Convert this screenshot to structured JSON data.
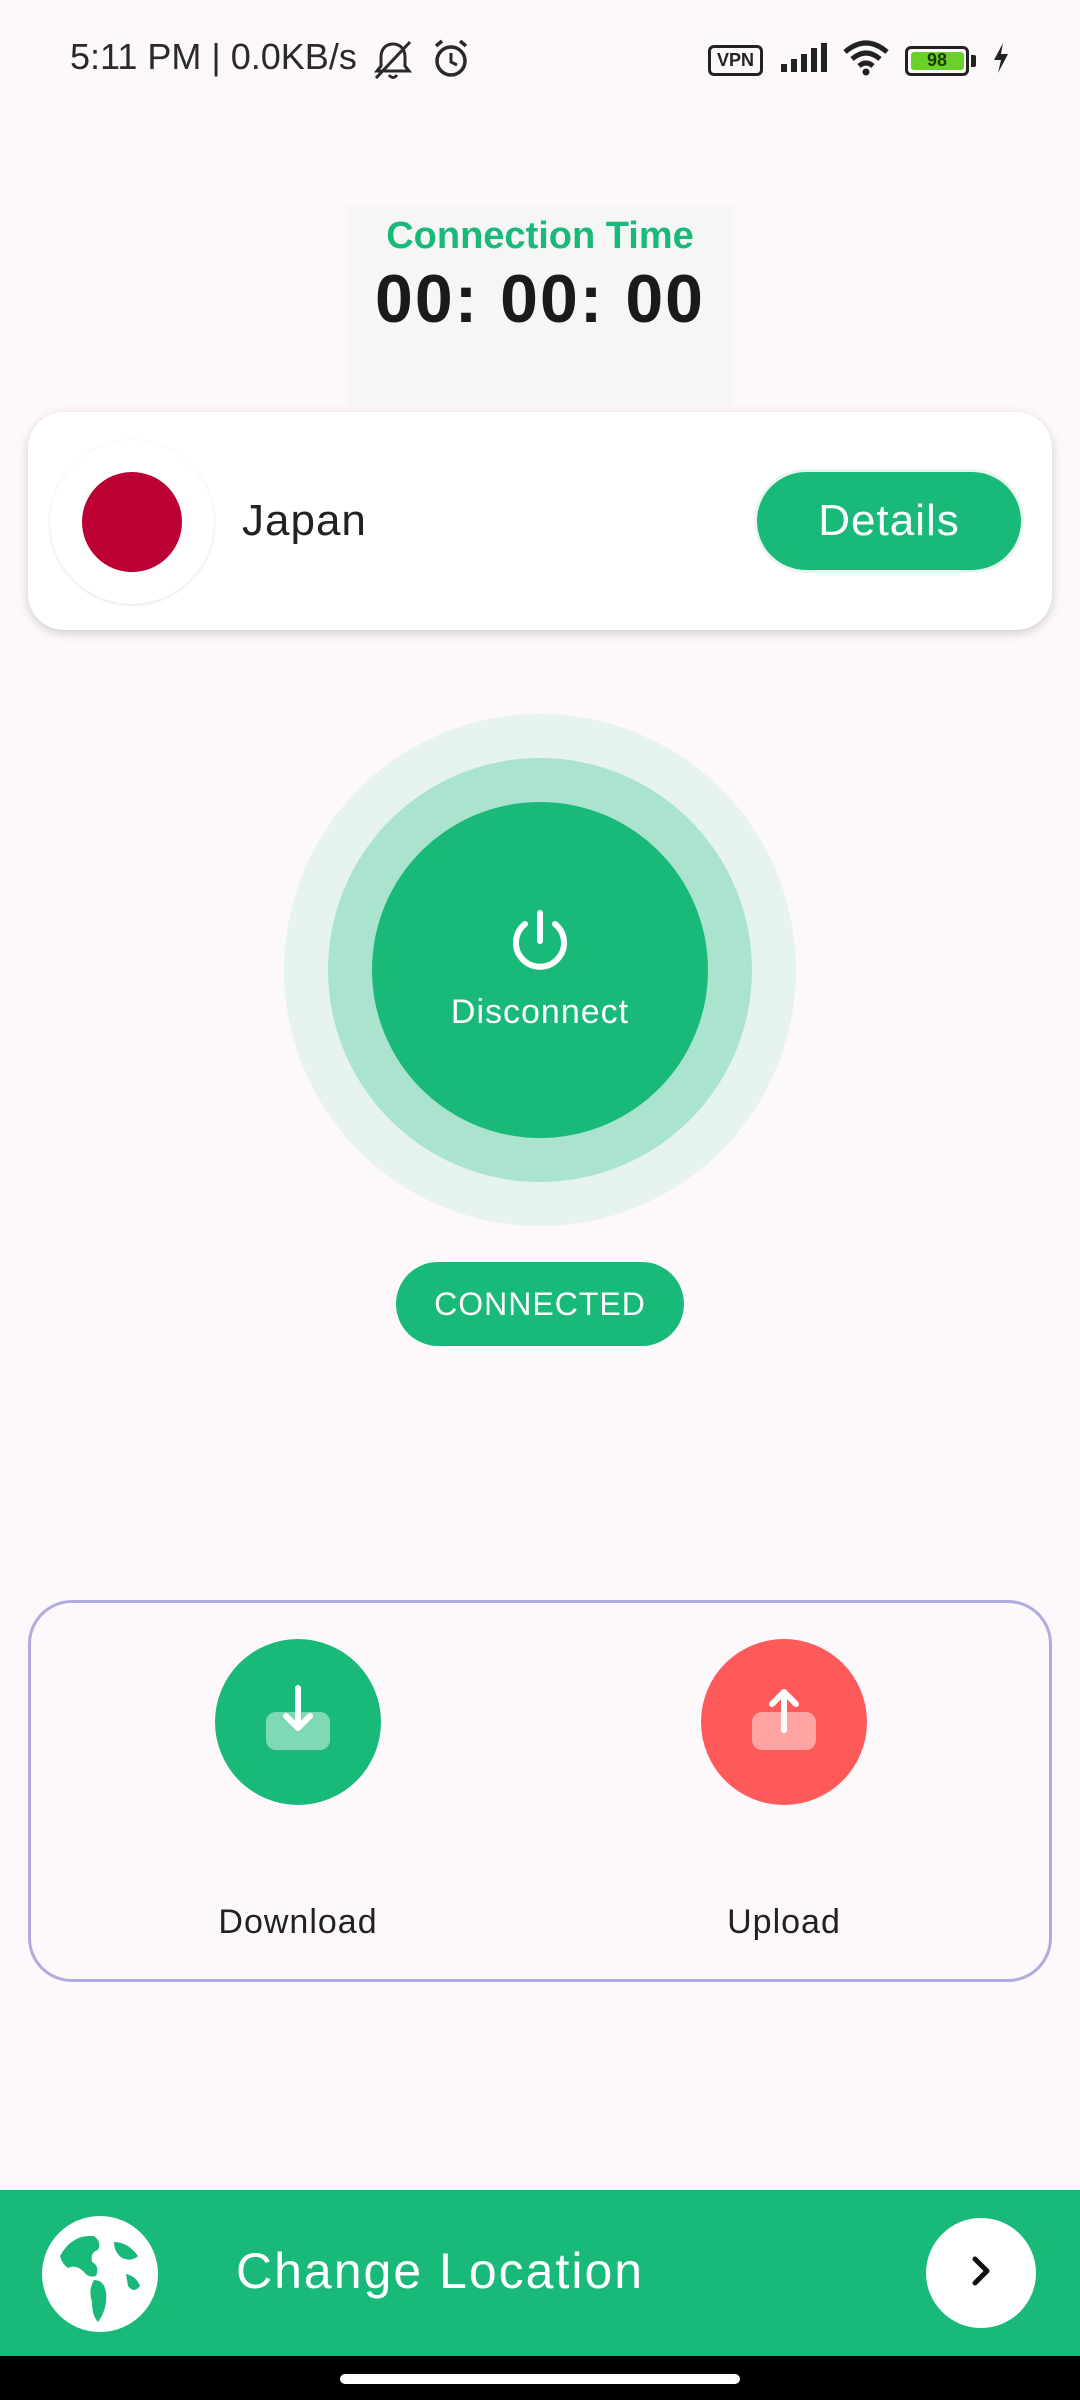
{
  "status_bar": {
    "time": "5:11 PM | 0.0KB/s",
    "vpn_label": "VPN",
    "battery": "98",
    "icons": [
      "mute-bell-icon",
      "alarm-icon",
      "signal-icon",
      "wifi-icon",
      "charging-icon"
    ]
  },
  "connection": {
    "label": "Connection Time",
    "time": "00: 00: 00"
  },
  "location": {
    "country": "Japan",
    "details_label": "Details",
    "flag_colors": {
      "background": "#ffffff",
      "circle": "#bc0033"
    }
  },
  "power": {
    "label": "Disconnect",
    "status": "CONNECTED"
  },
  "speed": {
    "download_label": "Download",
    "upload_label": "Upload",
    "download_color": "#19b97a",
    "upload_color": "#fe5a5a"
  },
  "bottom": {
    "label": "Change Location"
  },
  "colors": {
    "accent": "#19b97a",
    "upload": "#fe5a5a",
    "panel_border": "#b1abe0"
  }
}
